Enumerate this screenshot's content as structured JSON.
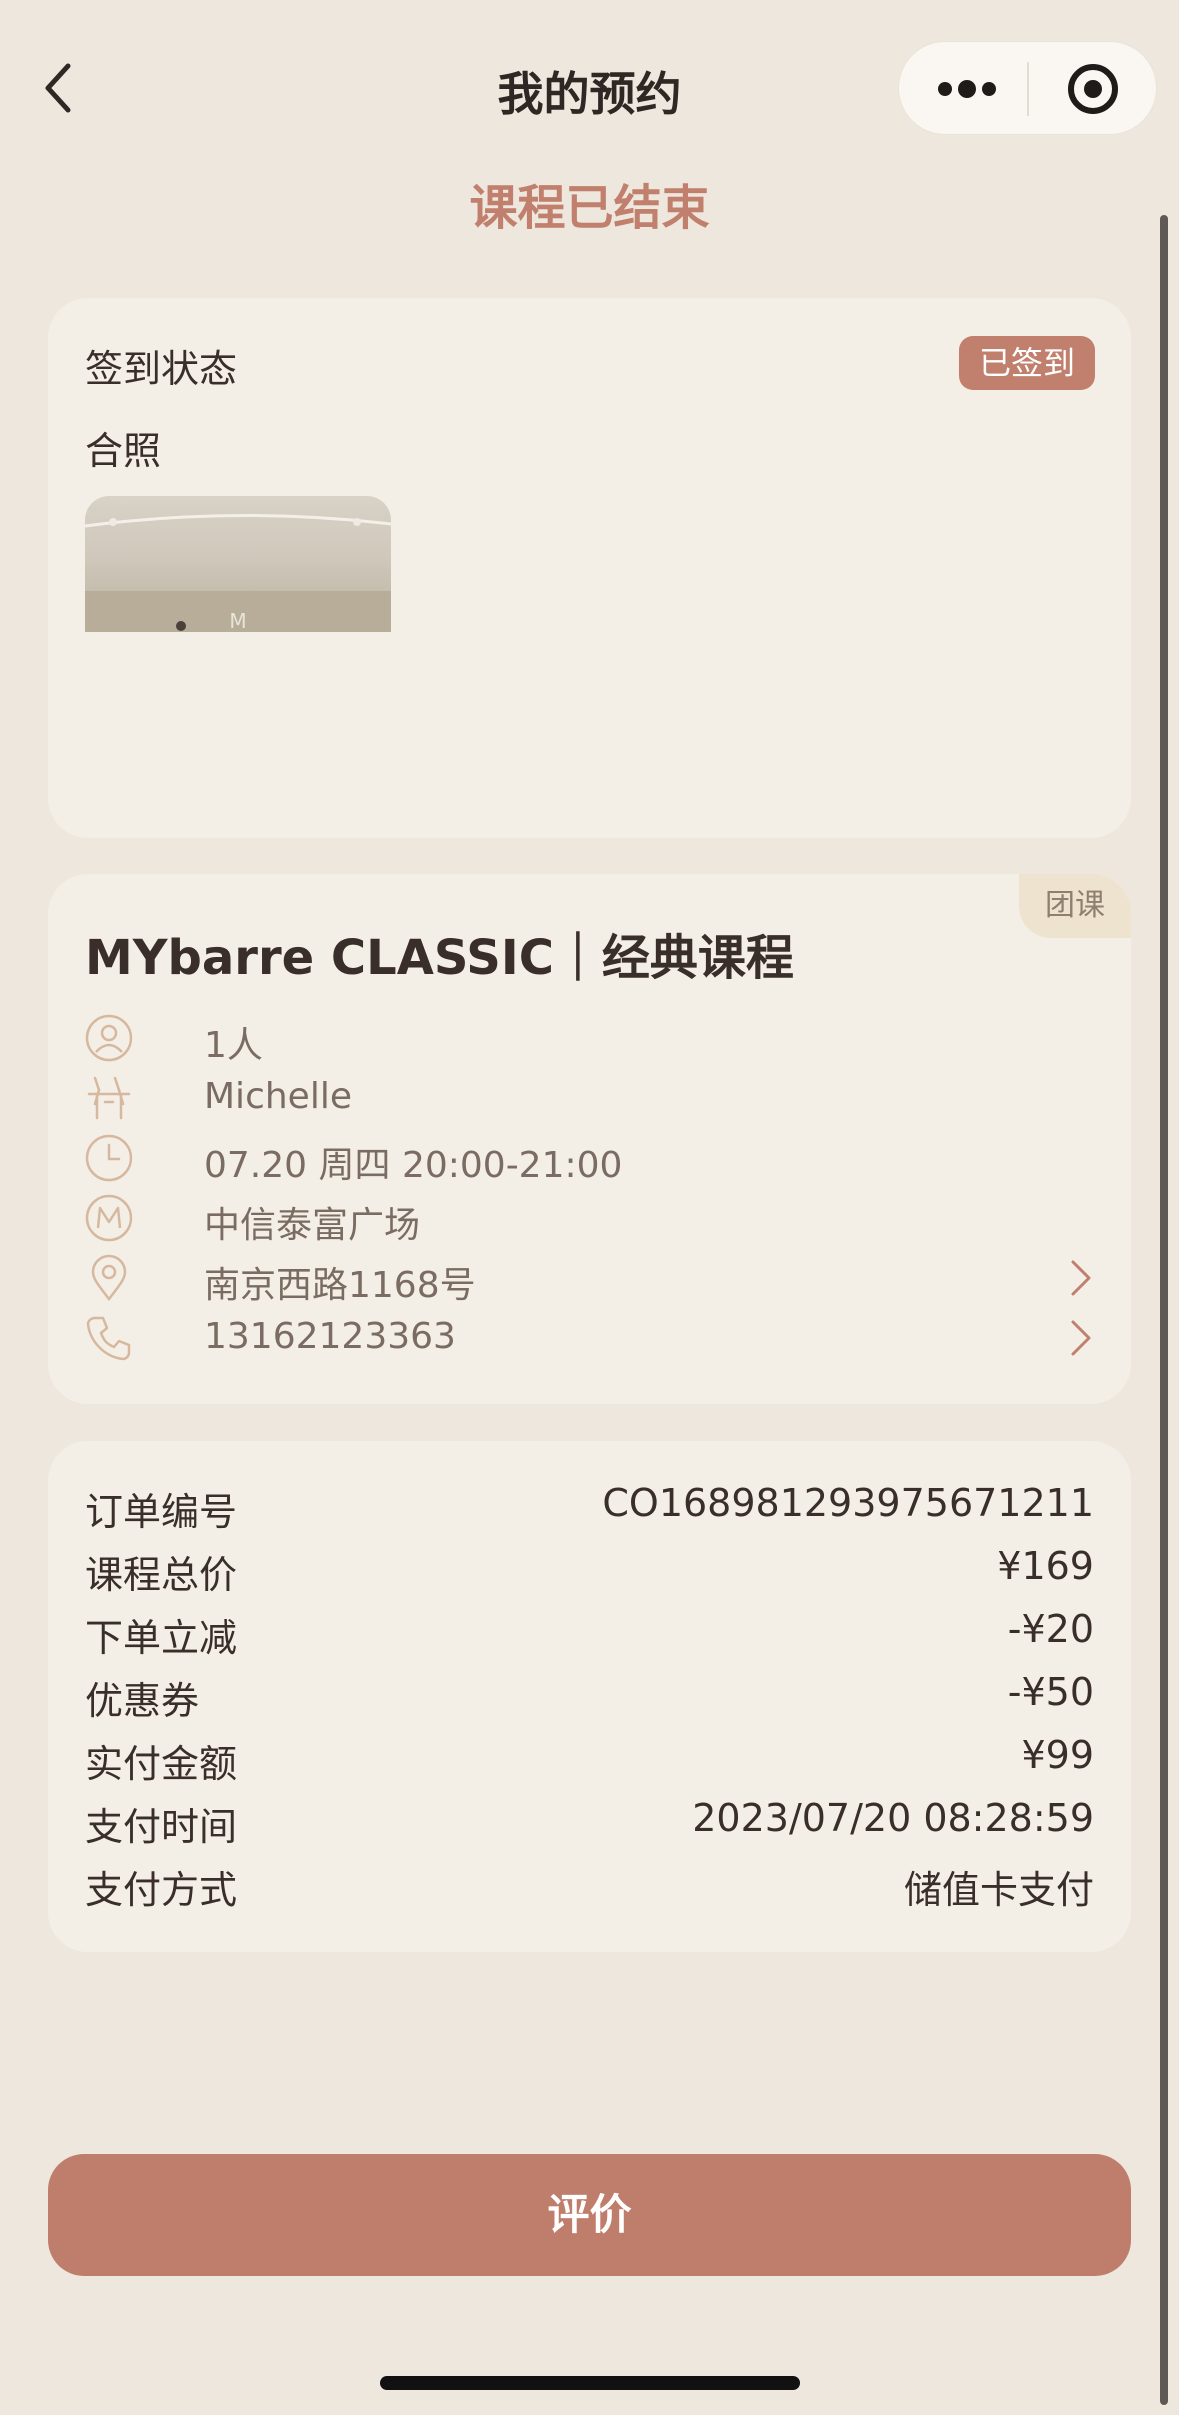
{
  "header": {
    "title": "我的预约",
    "back_icon": "chevron-left-icon",
    "more_icon": "more-dots-icon",
    "close_icon": "target-icon"
  },
  "status_text": "课程已结束",
  "checkin": {
    "status_label": "签到状态",
    "status_badge": "已签到",
    "photo_label": "合照"
  },
  "course": {
    "tag": "团课",
    "title": "MYbarre CLASSIC｜经典课程",
    "rows": [
      {
        "icon": "person-icon",
        "text": "1人"
      },
      {
        "icon": "barre-figure-icon",
        "text": "Michelle"
      },
      {
        "icon": "clock-icon",
        "text": "07.20 周四 20:00-21:00"
      },
      {
        "icon": "m-logo-icon",
        "text": "中信泰富广场"
      },
      {
        "icon": "location-pin-icon",
        "text": "南京西路1168号"
      },
      {
        "icon": "phone-icon",
        "text": "13162123363"
      }
    ]
  },
  "order": {
    "rows": [
      {
        "label": "订单编号",
        "value": "CO168981293975671211"
      },
      {
        "label": "课程总价",
        "value": "¥169"
      },
      {
        "label": "下单立减",
        "value": "-¥20"
      },
      {
        "label": "优惠券",
        "value": "-¥50"
      },
      {
        "label": "实付金额",
        "value": "¥99"
      },
      {
        "label": "支付时间",
        "value": "2023/07/20 08:28:59"
      },
      {
        "label": "支付方式",
        "value": "储值卡支付"
      }
    ]
  },
  "review_button": "评价",
  "colors": {
    "background": "#EEE7DD",
    "card": "#F4EFE6",
    "accent": "#C0806D",
    "icon": "#D6B89F"
  }
}
